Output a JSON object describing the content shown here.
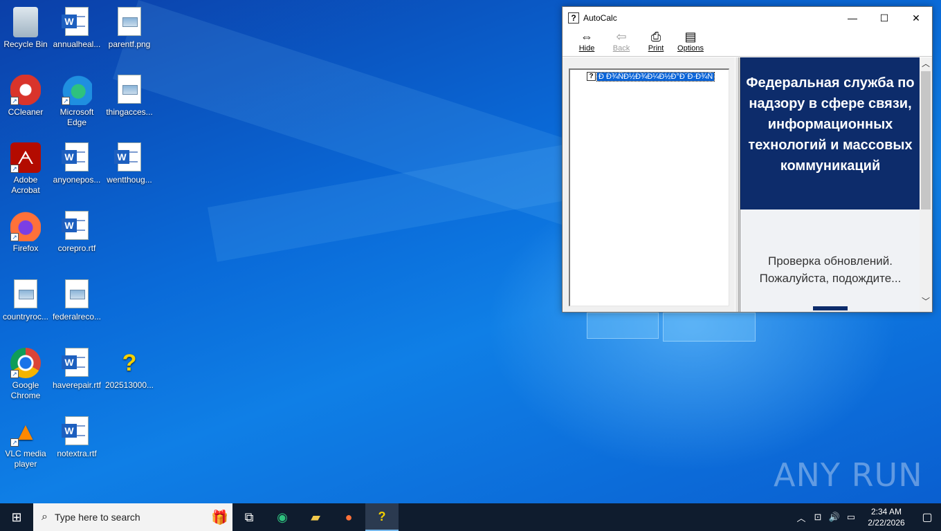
{
  "desktop": {
    "icons": [
      {
        "label": "Recycle Bin",
        "icon": "recycle-bin-icon"
      },
      {
        "label": "annualheal...",
        "icon": "word-doc-icon"
      },
      {
        "label": "parentf.png",
        "icon": "image-file-icon"
      },
      {
        "label": "CCleaner",
        "icon": "ccleaner-icon"
      },
      {
        "label": "Microsoft Edge",
        "icon": "edge-icon"
      },
      {
        "label": "thingacces...",
        "icon": "image-file-icon"
      },
      {
        "label": "Adobe Acrobat",
        "icon": "acrobat-icon"
      },
      {
        "label": "anyonepos...",
        "icon": "word-doc-icon"
      },
      {
        "label": "wentthoug...",
        "icon": "word-doc-icon"
      },
      {
        "label": "Firefox",
        "icon": "firefox-icon"
      },
      {
        "label": "corepro.rtf",
        "icon": "word-doc-icon"
      },
      {
        "label": "countryroc...",
        "icon": "image-file-icon"
      },
      {
        "label": "federalreco...",
        "icon": "image-file-icon"
      },
      {
        "label": "Google Chrome",
        "icon": "chrome-icon"
      },
      {
        "label": "haverepair.rtf",
        "icon": "word-doc-icon"
      },
      {
        "label": "202513000...",
        "icon": "help-file-icon"
      },
      {
        "label": "VLC media player",
        "icon": "vlc-icon"
      },
      {
        "label": "notextra.rtf",
        "icon": "word-doc-icon"
      }
    ],
    "watermark": "ANY RUN"
  },
  "window": {
    "title": "AutoCalc",
    "toolbar": {
      "hide": "Hide",
      "back": "Back",
      "print": "Print",
      "options": "Options"
    },
    "tree": {
      "item": "Ð Ð¾ÑÐ½Ð¾Ð¼Ð½Ð°Ð´Ð·Ð¾Ñ"
    },
    "content": {
      "banner": "Федеральная служба по надзору в сфере связи, информационных технологий и массовых коммуникаций",
      "wait_line1": "Проверка обновлений.",
      "wait_line2": "Пожалуйста, подождите..."
    }
  },
  "taskbar": {
    "search_placeholder": "Type here to search",
    "time": "2:34 AM",
    "date": "2/22/2026"
  }
}
